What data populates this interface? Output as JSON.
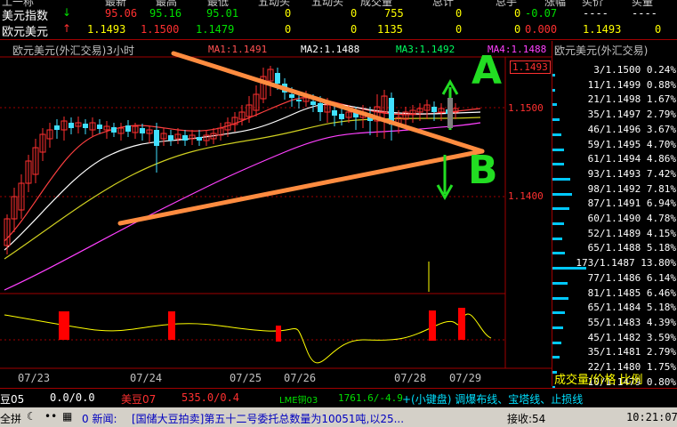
{
  "top_header": {
    "c0": "工一称",
    "c1": "最新",
    "c2": "最高",
    "c3": "最低",
    "c4": "五动头",
    "c5": "五动头",
    "c6": "成交量",
    "c7": "总计",
    "c8": "总手",
    "c9": "涨幅",
    "c10": "买价",
    "c11": "买量"
  },
  "rows": [
    {
      "name": "美元指数",
      "arrow": "↓",
      "last": "95.06",
      "high": "95.16",
      "low": "95.01",
      "v1": "0",
      "v2": "0",
      "vol": "755",
      "v3": "0",
      "v4": "0",
      "chg": "-0.07",
      "bid": "----",
      "bidvol": "----"
    },
    {
      "name": "欧元美元",
      "arrow": "↑",
      "last": "1.1493",
      "high": "1.1500",
      "low": "1.1479",
      "v1": "0",
      "v2": "0",
      "vol": "1135",
      "v3": "0",
      "v4": "0",
      "chg": "0.000",
      "bid": "1.1493",
      "bidvol": "0"
    }
  ],
  "chart_header": {
    "title": "欧元美元(外汇交易)3小时",
    "ma1": "MA1:1.1491",
    "ma2": "MA2:1.1488",
    "ma3": "MA3:1.1492",
    "ma4": "MA4:1.1488"
  },
  "annotations": {
    "a_label": "A",
    "b_label": "B"
  },
  "chart_data": {
    "type": "candlestick",
    "title": "欧元美元(外汇交易)3小时",
    "price_labels": [
      "1.1493",
      "1.1500",
      "1.1400"
    ],
    "x_ticks": [
      "07/23",
      "07/24",
      "07/25",
      "07/26",
      "07/28",
      "07/29"
    ],
    "ma_lines": [
      {
        "name": "MA1",
        "value": 1.1491
      },
      {
        "name": "MA2",
        "value": 1.1488
      },
      {
        "name": "MA3",
        "value": 1.1492
      },
      {
        "name": "MA4",
        "value": 1.1488
      }
    ],
    "ylim": [
      1.137,
      1.155
    ]
  },
  "right_panel": {
    "title": "欧元美元(外汇交易)",
    "rows": [
      {
        "q": "3/",
        "p": "1.1500",
        "pct": "0.24%"
      },
      {
        "q": "11/",
        "p": "1.1499",
        "pct": "0.88%"
      },
      {
        "q": "21/",
        "p": "1.1498",
        "pct": "1.67%"
      },
      {
        "q": "35/",
        "p": "1.1497",
        "pct": "2.79%"
      },
      {
        "q": "46/",
        "p": "1.1496",
        "pct": "3.67%"
      },
      {
        "q": "59/",
        "p": "1.1495",
        "pct": "4.70%"
      },
      {
        "q": "61/",
        "p": "1.1494",
        "pct": "4.86%"
      },
      {
        "q": "93/",
        "p": "1.1493",
        "pct": "7.42%"
      },
      {
        "q": "98/",
        "p": "1.1492",
        "pct": "7.81%"
      },
      {
        "q": "87/",
        "p": "1.1491",
        "pct": "6.94%"
      },
      {
        "q": "60/",
        "p": "1.1490",
        "pct": "4.78%"
      },
      {
        "q": "52/",
        "p": "1.1489",
        "pct": "4.15%"
      },
      {
        "q": "65/",
        "p": "1.1488",
        "pct": "5.18%"
      },
      {
        "q": "173/",
        "p": "1.1487",
        "pct": "13.80%"
      },
      {
        "q": "77/",
        "p": "1.1486",
        "pct": "6.14%"
      },
      {
        "q": "81/",
        "p": "1.1485",
        "pct": "6.46%"
      },
      {
        "q": "65/",
        "p": "1.1484",
        "pct": "5.18%"
      },
      {
        "q": "55/",
        "p": "1.1483",
        "pct": "4.39%"
      },
      {
        "q": "45/",
        "p": "1.1482",
        "pct": "3.59%"
      },
      {
        "q": "35/",
        "p": "1.1481",
        "pct": "2.79%"
      },
      {
        "q": "22/",
        "p": "1.1480",
        "pct": "1.75%"
      },
      {
        "q": "10/",
        "p": "1.1479",
        "pct": "0.80%"
      }
    ],
    "footer": "成交量/价格 比例"
  },
  "ticker": {
    "t1_name": "豆05",
    "t1_val": "0.0/0.0",
    "t2_name": "美豆07",
    "t2_val": "535.0/0.4",
    "t3_name": "LME铜03",
    "t3_val": "1761.6/-4.9",
    "hint": "+(小键盘) 调爆布线、宝塔线、止损线"
  },
  "status": {
    "left": "全拼",
    "news_prefix": "0 新闻:",
    "news": "[国储大豆拍卖]第五十二号委托总数量为10051吨,以25...",
    "recv": "接收:54",
    "time": "10:21:07"
  }
}
